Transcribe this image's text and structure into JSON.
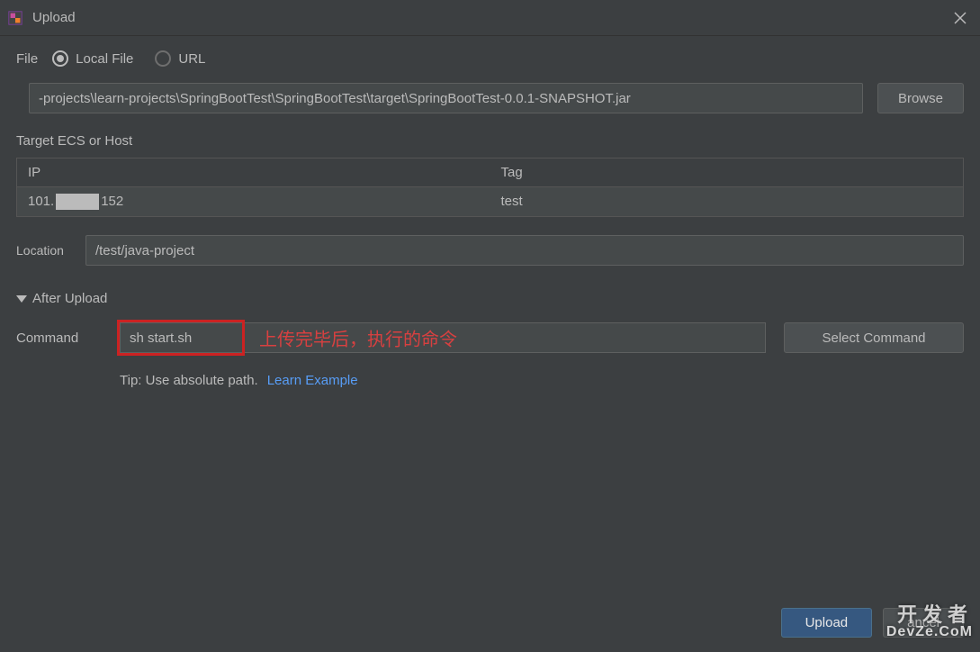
{
  "titlebar": {
    "title": "Upload"
  },
  "file_section": {
    "label": "File",
    "local_file": "Local File",
    "url": "URL",
    "path": "-projects\\learn-projects\\SpringBootTest\\SpringBootTest\\target\\SpringBootTest-0.0.1-SNAPSHOT.jar",
    "browse": "Browse"
  },
  "target_section": {
    "label": "Target ECS or Host",
    "headers": {
      "ip": "IP",
      "tag": "Tag"
    },
    "row": {
      "ip_prefix": "101.",
      "ip_suffix": "152",
      "tag": "test"
    }
  },
  "location": {
    "label": "Location",
    "value": "/test/java-project"
  },
  "after_upload": {
    "label": "After Upload",
    "command_label": "Command",
    "command_value": "sh start.sh",
    "annotation": "上传完毕后，执行的命令",
    "select_command": "Select Command",
    "tip": "Tip: Use absolute path.",
    "learn_example": "Learn Example"
  },
  "footer": {
    "upload": "Upload",
    "cancel": "ancel"
  },
  "watermark": {
    "cn": "开发者",
    "en": "DevZe.CoM"
  }
}
